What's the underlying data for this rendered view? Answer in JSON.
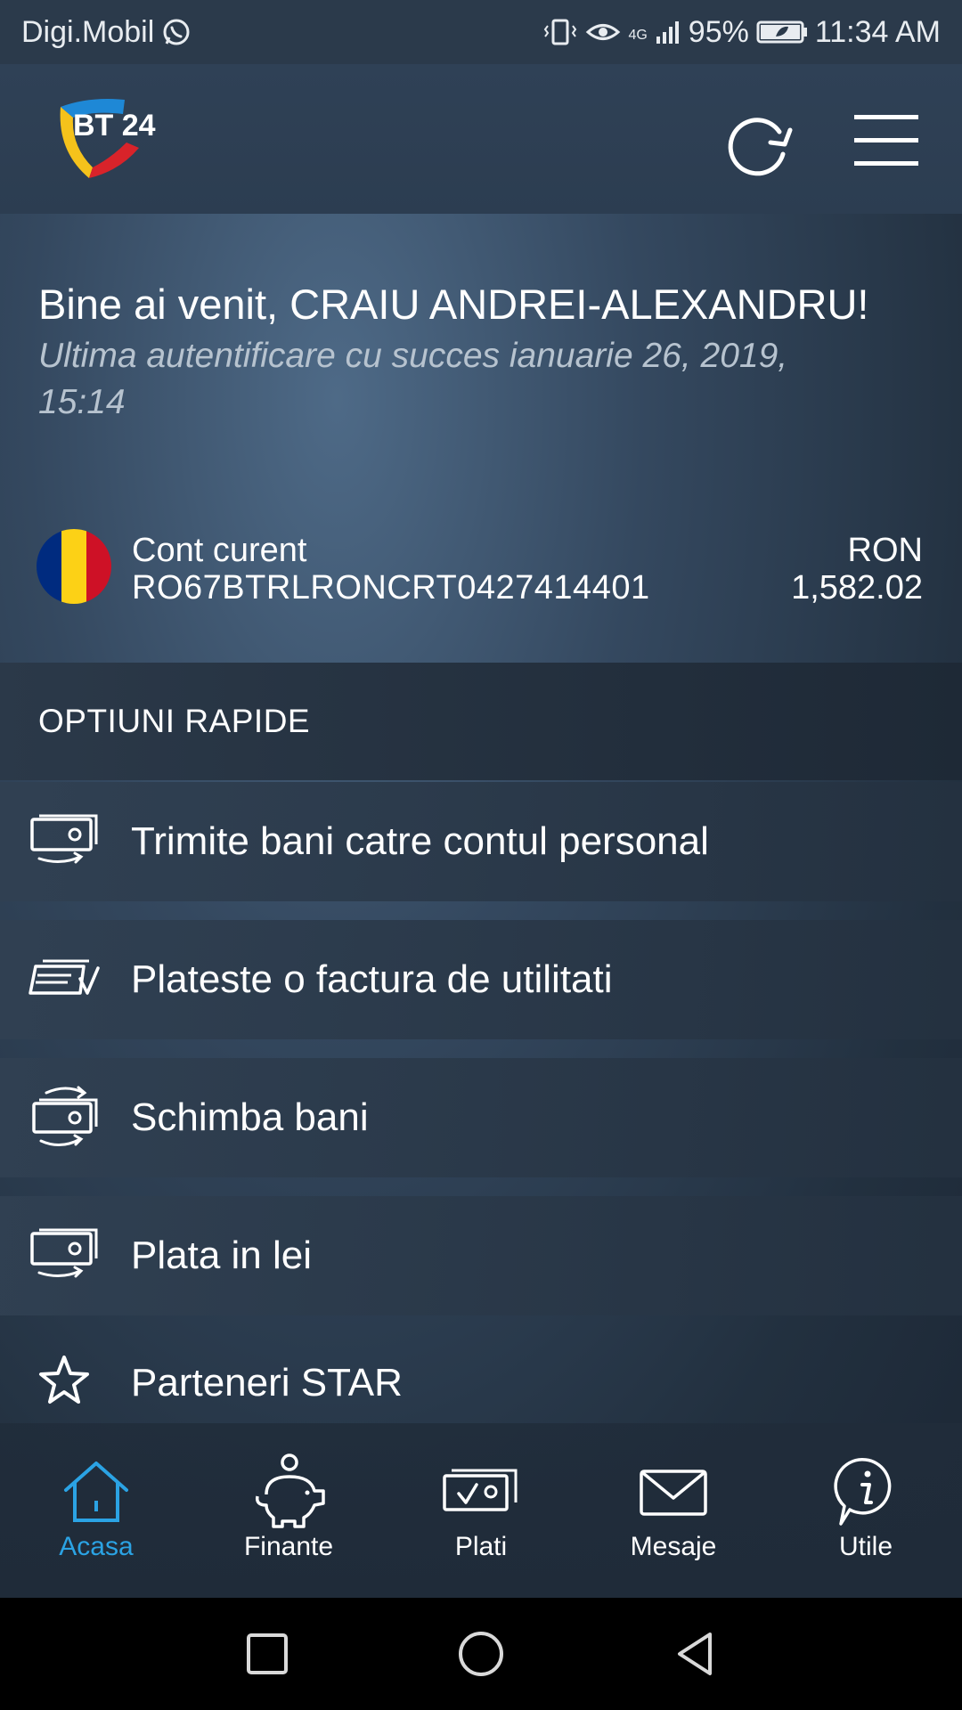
{
  "status_bar": {
    "carrier": "Digi.Mobil",
    "network": "4G",
    "battery": "95%",
    "time": "11:34 AM"
  },
  "header": {
    "logo_text": "BT 24",
    "refresh_icon": "refresh-icon",
    "menu_icon": "hamburger-menu-icon"
  },
  "welcome": {
    "title": "Bine ai venit, CRAIU ANDREI-ALEXANDRU!",
    "subtitle": "Ultima autentificare cu succes ianuarie 26, 2019, 15:14"
  },
  "account": {
    "name": "Cont curent",
    "iban": "RO67BTRLRONCRT0427414401",
    "currency": "RON",
    "balance": "1,582.02",
    "flag_colors": [
      "#002b7f",
      "#fcd116",
      "#ce1126"
    ]
  },
  "quick_options": {
    "title": "OPTIUNI RAPIDE",
    "items": [
      {
        "label": "Trimite bani catre contul personal",
        "icon": "money-transfer-icon"
      },
      {
        "label": "Plateste o factura de utilitati",
        "icon": "bill-payment-icon"
      },
      {
        "label": "Schimba bani",
        "icon": "currency-exchange-icon"
      },
      {
        "label": "Plata in lei",
        "icon": "payment-lei-icon"
      },
      {
        "label": "Parteneri STAR",
        "icon": "star-icon"
      }
    ]
  },
  "bottom_nav": {
    "items": [
      {
        "label": "Acasa",
        "icon": "home-icon",
        "active": true
      },
      {
        "label": "Finante",
        "icon": "piggy-bank-icon",
        "active": false
      },
      {
        "label": "Plati",
        "icon": "payments-icon",
        "active": false
      },
      {
        "label": "Mesaje",
        "icon": "envelope-icon",
        "active": false
      },
      {
        "label": "Utile",
        "icon": "info-icon",
        "active": false
      }
    ]
  },
  "colors": {
    "accent": "#2ba3e4",
    "background": "#2c3d51"
  }
}
